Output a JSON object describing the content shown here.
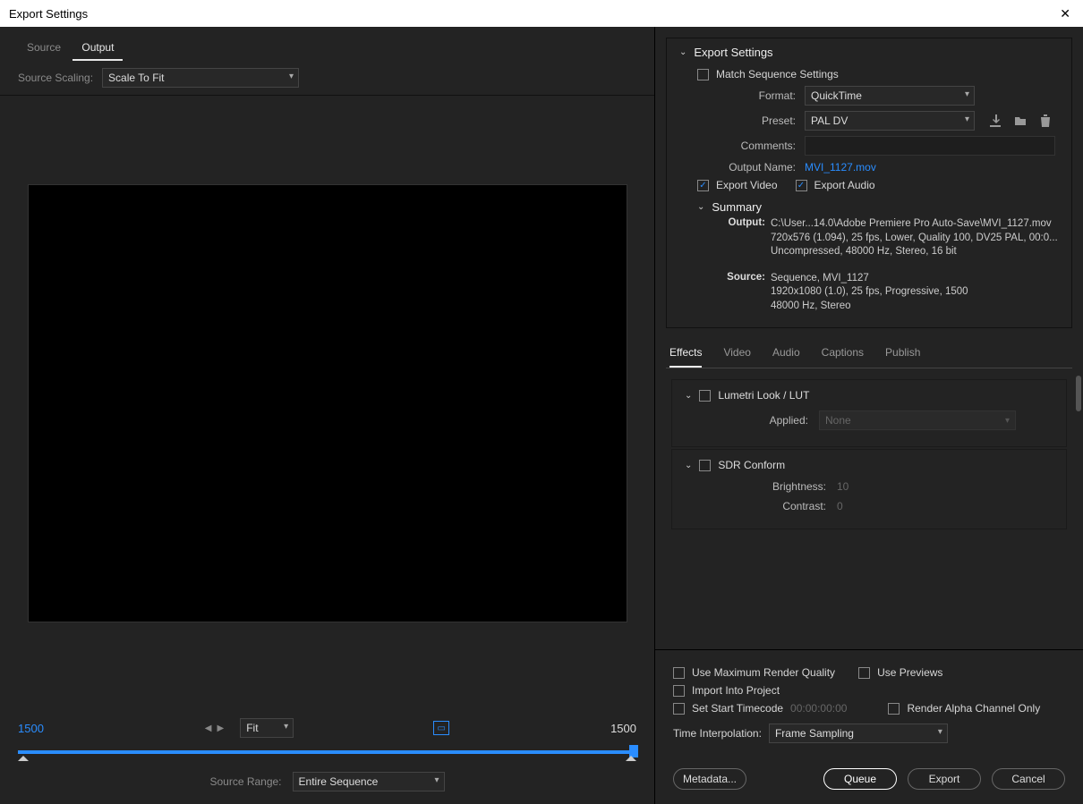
{
  "titlebar": {
    "title": "Export Settings"
  },
  "left": {
    "tabs": {
      "source": "Source",
      "output": "Output"
    },
    "sourceScaling": {
      "label": "Source Scaling:",
      "value": "Scale To Fit"
    },
    "timecode": {
      "in": "1500",
      "out": "1500"
    },
    "fit": {
      "value": "Fit"
    },
    "sourceRange": {
      "label": "Source Range:",
      "value": "Entire Sequence"
    }
  },
  "export": {
    "header": "Export Settings",
    "match": {
      "label": "Match Sequence Settings"
    },
    "format": {
      "label": "Format:",
      "value": "QuickTime"
    },
    "preset": {
      "label": "Preset:",
      "value": "PAL DV"
    },
    "comments": {
      "label": "Comments:",
      "value": ""
    },
    "outputName": {
      "label": "Output Name:",
      "value": "MVI_1127.mov"
    },
    "exportVideo": {
      "label": "Export Video"
    },
    "exportAudio": {
      "label": "Export Audio"
    },
    "summary": {
      "header": "Summary",
      "output": {
        "label": "Output:",
        "line1": "C:\\User...14.0\\Adobe Premiere Pro Auto-Save\\MVI_1127.mov",
        "line2": "720x576 (1.094), 25 fps, Lower, Quality 100, DV25 PAL, 00:0...",
        "line3": "Uncompressed, 48000 Hz, Stereo, 16 bit"
      },
      "source": {
        "label": "Source:",
        "line1": "Sequence, MVI_1127",
        "line2": "1920x1080 (1.0), 25 fps, Progressive, 1500",
        "line3": "48000 Hz, Stereo"
      }
    }
  },
  "subTabs": {
    "effects": "Effects",
    "video": "Video",
    "audio": "Audio",
    "captions": "Captions",
    "publish": "Publish"
  },
  "effects": {
    "lumetri": {
      "title": "Lumetri Look / LUT",
      "applied": {
        "label": "Applied:",
        "value": "None"
      }
    },
    "sdr": {
      "title": "SDR Conform",
      "brightness": {
        "label": "Brightness:",
        "value": "10"
      },
      "contrast": {
        "label": "Contrast:",
        "value": "0"
      }
    }
  },
  "bottom": {
    "maxRender": "Use Maximum Render Quality",
    "usePreviews": "Use Previews",
    "importProject": "Import Into Project",
    "startTimecode": "Set Start Timecode",
    "startTimecodeVal": "00:00:00:00",
    "renderAlpha": "Render Alpha Channel Only",
    "timeInterp": {
      "label": "Time Interpolation:",
      "value": "Frame Sampling"
    }
  },
  "buttons": {
    "metadata": "Metadata...",
    "queue": "Queue",
    "export": "Export",
    "cancel": "Cancel"
  }
}
